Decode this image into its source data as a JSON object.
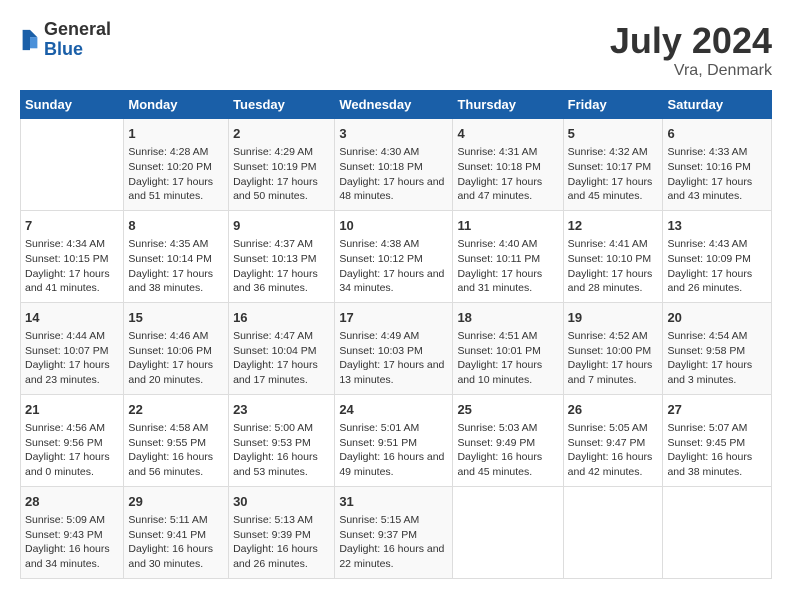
{
  "logo": {
    "general": "General",
    "blue": "Blue"
  },
  "header": {
    "title": "July 2024",
    "subtitle": "Vra, Denmark"
  },
  "days_of_week": [
    "Sunday",
    "Monday",
    "Tuesday",
    "Wednesday",
    "Thursday",
    "Friday",
    "Saturday"
  ],
  "weeks": [
    [
      {
        "day": null,
        "data": null
      },
      {
        "day": "1",
        "data": "Sunrise: 4:28 AM\nSunset: 10:20 PM\nDaylight: 17 hours and 51 minutes."
      },
      {
        "day": "2",
        "data": "Sunrise: 4:29 AM\nSunset: 10:19 PM\nDaylight: 17 hours and 50 minutes."
      },
      {
        "day": "3",
        "data": "Sunrise: 4:30 AM\nSunset: 10:18 PM\nDaylight: 17 hours and 48 minutes."
      },
      {
        "day": "4",
        "data": "Sunrise: 4:31 AM\nSunset: 10:18 PM\nDaylight: 17 hours and 47 minutes."
      },
      {
        "day": "5",
        "data": "Sunrise: 4:32 AM\nSunset: 10:17 PM\nDaylight: 17 hours and 45 minutes."
      },
      {
        "day": "6",
        "data": "Sunrise: 4:33 AM\nSunset: 10:16 PM\nDaylight: 17 hours and 43 minutes."
      }
    ],
    [
      {
        "day": "7",
        "data": "Sunrise: 4:34 AM\nSunset: 10:15 PM\nDaylight: 17 hours and 41 minutes."
      },
      {
        "day": "8",
        "data": "Sunrise: 4:35 AM\nSunset: 10:14 PM\nDaylight: 17 hours and 38 minutes."
      },
      {
        "day": "9",
        "data": "Sunrise: 4:37 AM\nSunset: 10:13 PM\nDaylight: 17 hours and 36 minutes."
      },
      {
        "day": "10",
        "data": "Sunrise: 4:38 AM\nSunset: 10:12 PM\nDaylight: 17 hours and 34 minutes."
      },
      {
        "day": "11",
        "data": "Sunrise: 4:40 AM\nSunset: 10:11 PM\nDaylight: 17 hours and 31 minutes."
      },
      {
        "day": "12",
        "data": "Sunrise: 4:41 AM\nSunset: 10:10 PM\nDaylight: 17 hours and 28 minutes."
      },
      {
        "day": "13",
        "data": "Sunrise: 4:43 AM\nSunset: 10:09 PM\nDaylight: 17 hours and 26 minutes."
      }
    ],
    [
      {
        "day": "14",
        "data": "Sunrise: 4:44 AM\nSunset: 10:07 PM\nDaylight: 17 hours and 23 minutes."
      },
      {
        "day": "15",
        "data": "Sunrise: 4:46 AM\nSunset: 10:06 PM\nDaylight: 17 hours and 20 minutes."
      },
      {
        "day": "16",
        "data": "Sunrise: 4:47 AM\nSunset: 10:04 PM\nDaylight: 17 hours and 17 minutes."
      },
      {
        "day": "17",
        "data": "Sunrise: 4:49 AM\nSunset: 10:03 PM\nDaylight: 17 hours and 13 minutes."
      },
      {
        "day": "18",
        "data": "Sunrise: 4:51 AM\nSunset: 10:01 PM\nDaylight: 17 hours and 10 minutes."
      },
      {
        "day": "19",
        "data": "Sunrise: 4:52 AM\nSunset: 10:00 PM\nDaylight: 17 hours and 7 minutes."
      },
      {
        "day": "20",
        "data": "Sunrise: 4:54 AM\nSunset: 9:58 PM\nDaylight: 17 hours and 3 minutes."
      }
    ],
    [
      {
        "day": "21",
        "data": "Sunrise: 4:56 AM\nSunset: 9:56 PM\nDaylight: 17 hours and 0 minutes."
      },
      {
        "day": "22",
        "data": "Sunrise: 4:58 AM\nSunset: 9:55 PM\nDaylight: 16 hours and 56 minutes."
      },
      {
        "day": "23",
        "data": "Sunrise: 5:00 AM\nSunset: 9:53 PM\nDaylight: 16 hours and 53 minutes."
      },
      {
        "day": "24",
        "data": "Sunrise: 5:01 AM\nSunset: 9:51 PM\nDaylight: 16 hours and 49 minutes."
      },
      {
        "day": "25",
        "data": "Sunrise: 5:03 AM\nSunset: 9:49 PM\nDaylight: 16 hours and 45 minutes."
      },
      {
        "day": "26",
        "data": "Sunrise: 5:05 AM\nSunset: 9:47 PM\nDaylight: 16 hours and 42 minutes."
      },
      {
        "day": "27",
        "data": "Sunrise: 5:07 AM\nSunset: 9:45 PM\nDaylight: 16 hours and 38 minutes."
      }
    ],
    [
      {
        "day": "28",
        "data": "Sunrise: 5:09 AM\nSunset: 9:43 PM\nDaylight: 16 hours and 34 minutes."
      },
      {
        "day": "29",
        "data": "Sunrise: 5:11 AM\nSunset: 9:41 PM\nDaylight: 16 hours and 30 minutes."
      },
      {
        "day": "30",
        "data": "Sunrise: 5:13 AM\nSunset: 9:39 PM\nDaylight: 16 hours and 26 minutes."
      },
      {
        "day": "31",
        "data": "Sunrise: 5:15 AM\nSunset: 9:37 PM\nDaylight: 16 hours and 22 minutes."
      },
      {
        "day": null,
        "data": null
      },
      {
        "day": null,
        "data": null
      },
      {
        "day": null,
        "data": null
      }
    ]
  ]
}
